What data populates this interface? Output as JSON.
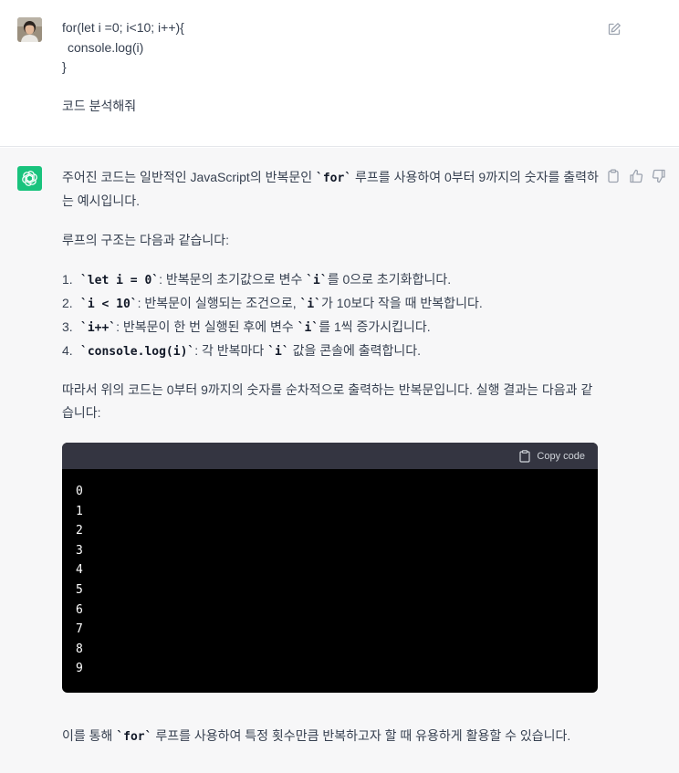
{
  "user_message": {
    "code_lines": [
      "for(let i =0; i<10; i++){",
      "console.log(i)",
      "}"
    ],
    "request": "코드 분석해줘"
  },
  "assistant_message": {
    "intro_before": "주어진 코드는 일반적인 JavaScript의 반복문인 ",
    "intro_code": "`for`",
    "intro_after": " 루프를 사용하여 0부터 9까지의 숫자를 출력하는 예시입니다.",
    "structure_heading": "루프의 구조는 다음과 같습니다:",
    "steps": [
      {
        "num": "1.",
        "code": "`let i = 0`",
        "text": ": 반복문의 초기값으로 변수 ",
        "code2": "`i`",
        "text2": "를 0으로 초기화합니다."
      },
      {
        "num": "2.",
        "code": "`i < 10`",
        "text": ": 반복문이 실행되는 조건으로, ",
        "code2": "`i`",
        "text2": "가 10보다 작을 때 반복합니다."
      },
      {
        "num": "3.",
        "code": "`i++`",
        "text": ": 반복문이 한 번 실행된 후에 변수 ",
        "code2": "`i`",
        "text2": "를 1씩 증가시킵니다."
      },
      {
        "num": "4.",
        "code": "`console.log(i)`",
        "text": ": 각 반복마다 ",
        "code2": "`i`",
        "text2": " 값을 콘솔에 출력합니다."
      }
    ],
    "result_intro": "따라서 위의 코드는 0부터 9까지의 숫자를 순차적으로 출력하는 반복문입니다. 실행 결과는 다음과 같습니다:",
    "copy_label": "Copy code",
    "output_lines": [
      "0",
      "1",
      "2",
      "3",
      "4",
      "5",
      "6",
      "7",
      "8",
      "9"
    ],
    "conclusion_before": "이를 통해 ",
    "conclusion_code": "`for`",
    "conclusion_after": " 루프를 사용하여 특정 횟수만큼 반복하고자 할 때 유용하게 활용할 수 있습니다."
  },
  "icons": {
    "user_avatar": "avatar",
    "edit": "edit-icon",
    "assistant_logo": "openai-logo-icon",
    "copy": "clipboard-icon",
    "thumbs_up": "thumbs-up-icon",
    "thumbs_down": "thumbs-down-icon"
  },
  "colors": {
    "assistant_bg": "#f7f7f8",
    "logo_green": "#19c37d",
    "code_header": "#343541",
    "code_body": "#000000"
  }
}
